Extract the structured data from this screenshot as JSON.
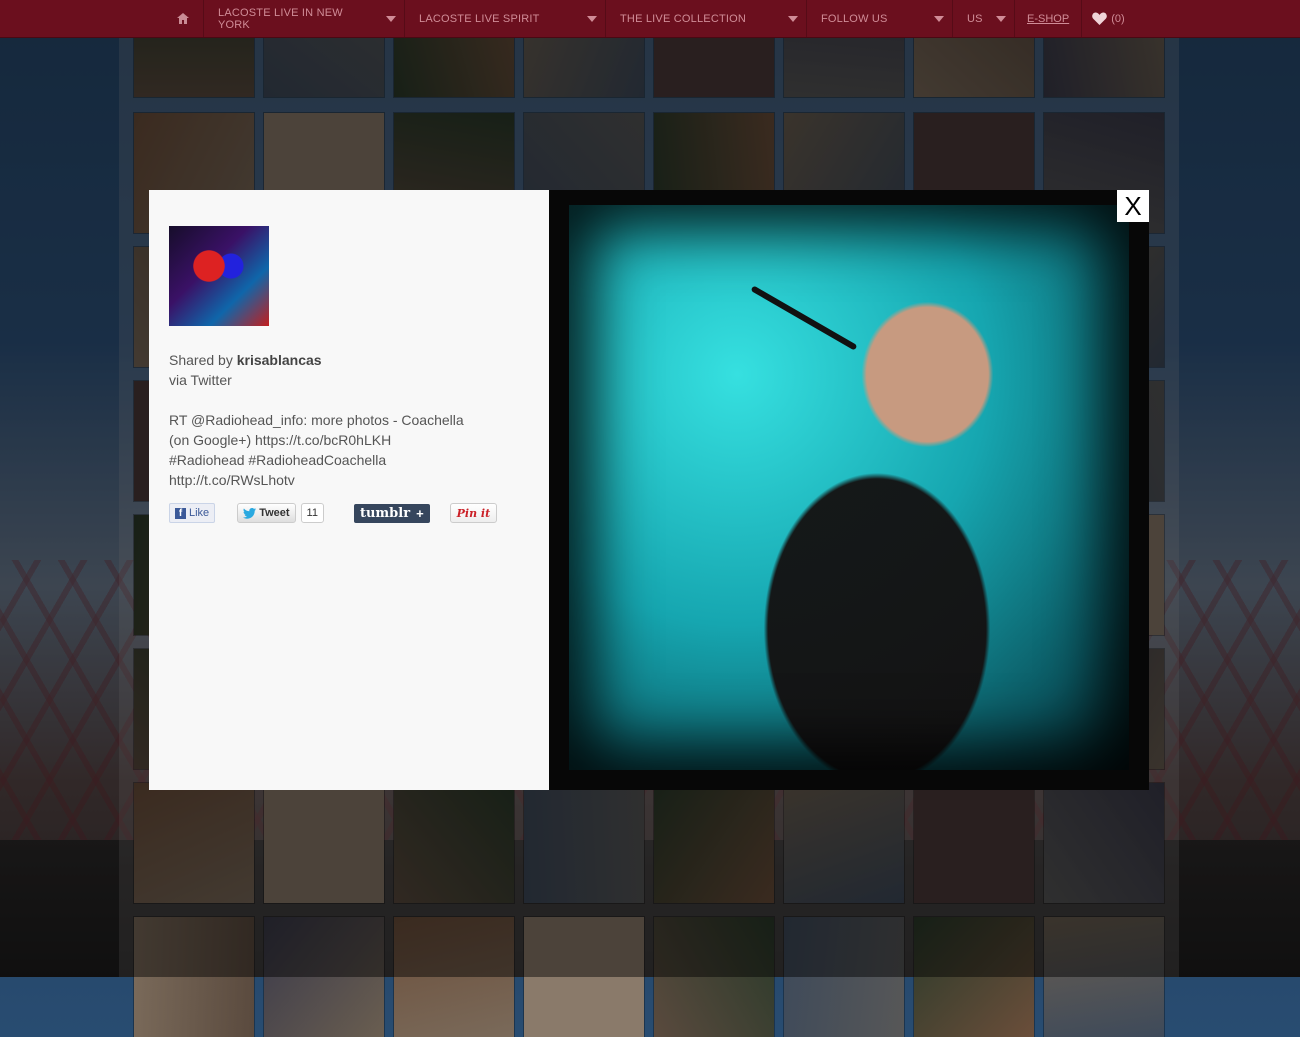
{
  "nav": {
    "items": [
      {
        "label": "LACOSTE LIVE IN NEW YORK"
      },
      {
        "label": "LACOSTE LIVE SPIRIT"
      },
      {
        "label": "THE LIVE COLLECTION"
      },
      {
        "label": "FOLLOW US"
      },
      {
        "label": "US"
      }
    ],
    "eshop": "E-SHOP",
    "favorites_count": "(0)"
  },
  "modal": {
    "shared_prefix": "Shared by",
    "username": "krisablancas",
    "via": "via Twitter",
    "tweet_lines": [
      "RT @Radiohead_info: more photos - Coachella",
      "(on Google+) https://t.co/bcR0hLKH",
      "#Radiohead #RadioheadCoachella",
      "http://t.co/RWsLhotv"
    ],
    "share": {
      "like": "Like",
      "tweet": "Tweet",
      "tweet_count": "11",
      "tumblr": "tumblr",
      "tumblr_plus": "+",
      "pinit": "Pin it"
    },
    "close": "X"
  },
  "colors": {
    "navbar": "#6b0f1e",
    "nav_text": "#d08c97",
    "panel": "#f8f8f8",
    "photo_bg": "#070707"
  },
  "icons": {
    "home": "home-icon",
    "caret": "chevron-down-icon",
    "favorites": "heart-icon"
  }
}
